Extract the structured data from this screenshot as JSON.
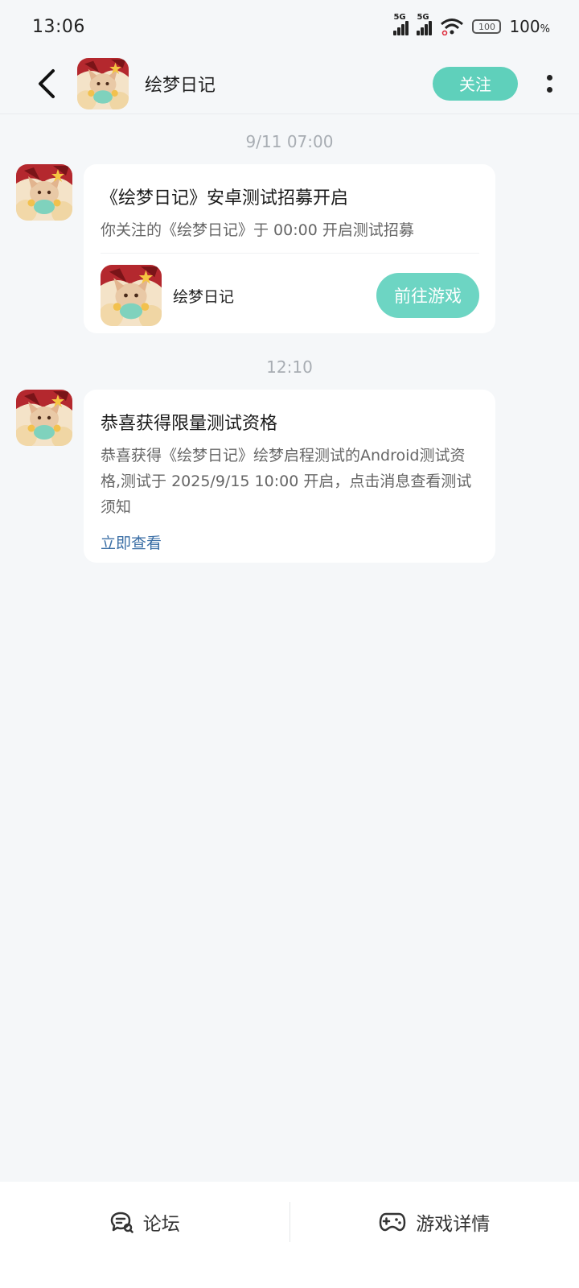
{
  "status_bar": {
    "time": "13:06",
    "network_1": "5G",
    "network_2": "5G",
    "battery_icon_text": "100",
    "battery_percent": "100",
    "battery_unit": "%"
  },
  "header": {
    "title": "绘梦日记",
    "follow_label": "关注"
  },
  "messages": [
    {
      "timestamp": "9/11  07:00",
      "title": "《绘梦日记》安卓测试招募开启",
      "body": "你关注的《绘梦日记》于 00:00 开启测试招募",
      "game_name": "绘梦日记",
      "action_label": "前往游戏"
    },
    {
      "timestamp": "12:10",
      "title": "恭喜获得限量测试资格",
      "body": "恭喜获得《绘梦日记》绘梦启程测试的Android测试资格,测试于 2025/9/15 10:00 开启，点击消息查看测试须知",
      "link_label": "立即查看"
    }
  ],
  "bottom_tabs": [
    {
      "label": "论坛",
      "icon": "forum-chat-icon"
    },
    {
      "label": "游戏详情",
      "icon": "gamepad-icon"
    }
  ],
  "colors": {
    "accent": "#5fd0bb",
    "background": "#f5f7f9",
    "link": "#3a6ea5"
  }
}
